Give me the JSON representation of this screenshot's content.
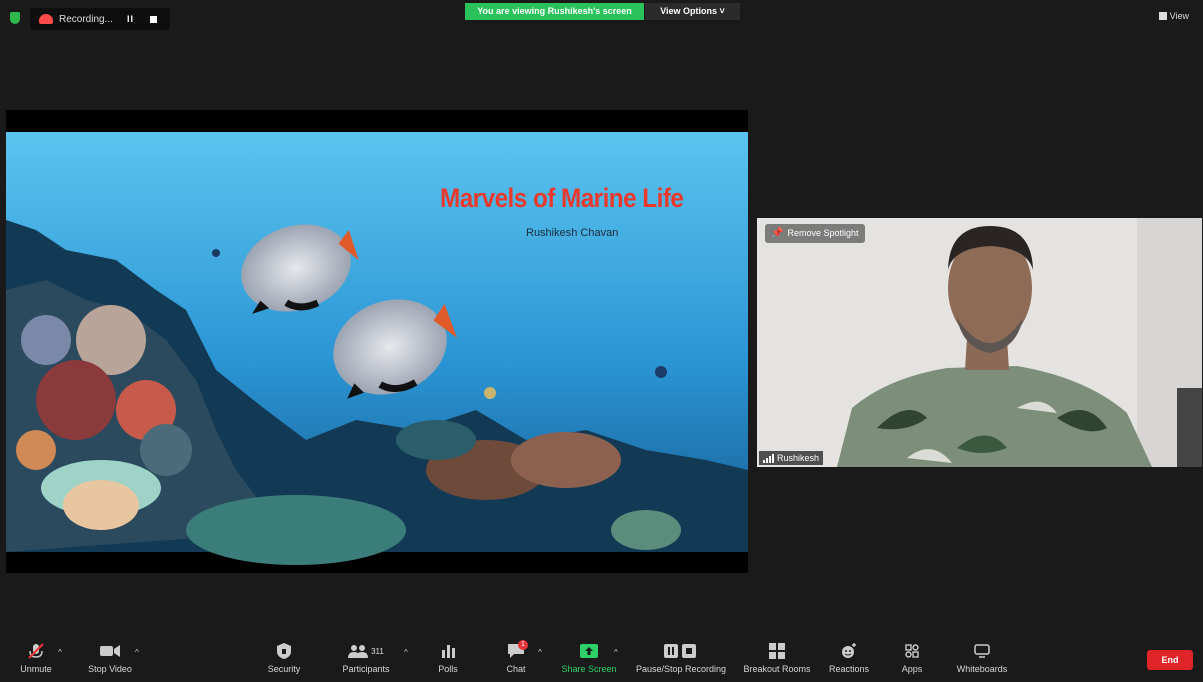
{
  "top": {
    "recording_label": "Recording...",
    "pause_glyph": "II",
    "viewing_banner": "You are viewing Rushikesh's screen",
    "view_options": "View Options",
    "view_options_caret": "˅",
    "view_label": "View"
  },
  "slide": {
    "title": "Marvels of Marine Life",
    "subtitle": "Rushikesh Chavan"
  },
  "video": {
    "remove_spotlight": "Remove Spotlight",
    "participant_name": "Rushikesh"
  },
  "toolbar": {
    "unmute": "Unmute",
    "stop_video": "Stop Video",
    "security": "Security",
    "participants": "Participants",
    "participants_count": "311",
    "polls": "Polls",
    "chat": "Chat",
    "chat_badge": "1",
    "share_screen": "Share Screen",
    "pause_stop_recording": "Pause/Stop Recording",
    "breakout_rooms": "Breakout Rooms",
    "reactions": "Reactions",
    "apps": "Apps",
    "whiteboards": "Whiteboards",
    "end": "End",
    "caret": "^"
  },
  "colors": {
    "background": "#1a1a1a",
    "green_accent": "#2ac25a",
    "end_red": "#e0252a",
    "title_red": "#e8392c"
  },
  "icons": [
    "shield-icon",
    "cloud-record-icon",
    "pause-icon",
    "stop-icon",
    "mic-muted-icon",
    "video-camera-icon",
    "security-shield-icon",
    "participants-icon",
    "polls-icon",
    "chat-icon",
    "share-screen-icon",
    "pause-stop-record-icon",
    "breakout-rooms-icon",
    "reactions-icon",
    "apps-icon",
    "whiteboards-icon",
    "pin-icon",
    "signal-bars-icon"
  ]
}
